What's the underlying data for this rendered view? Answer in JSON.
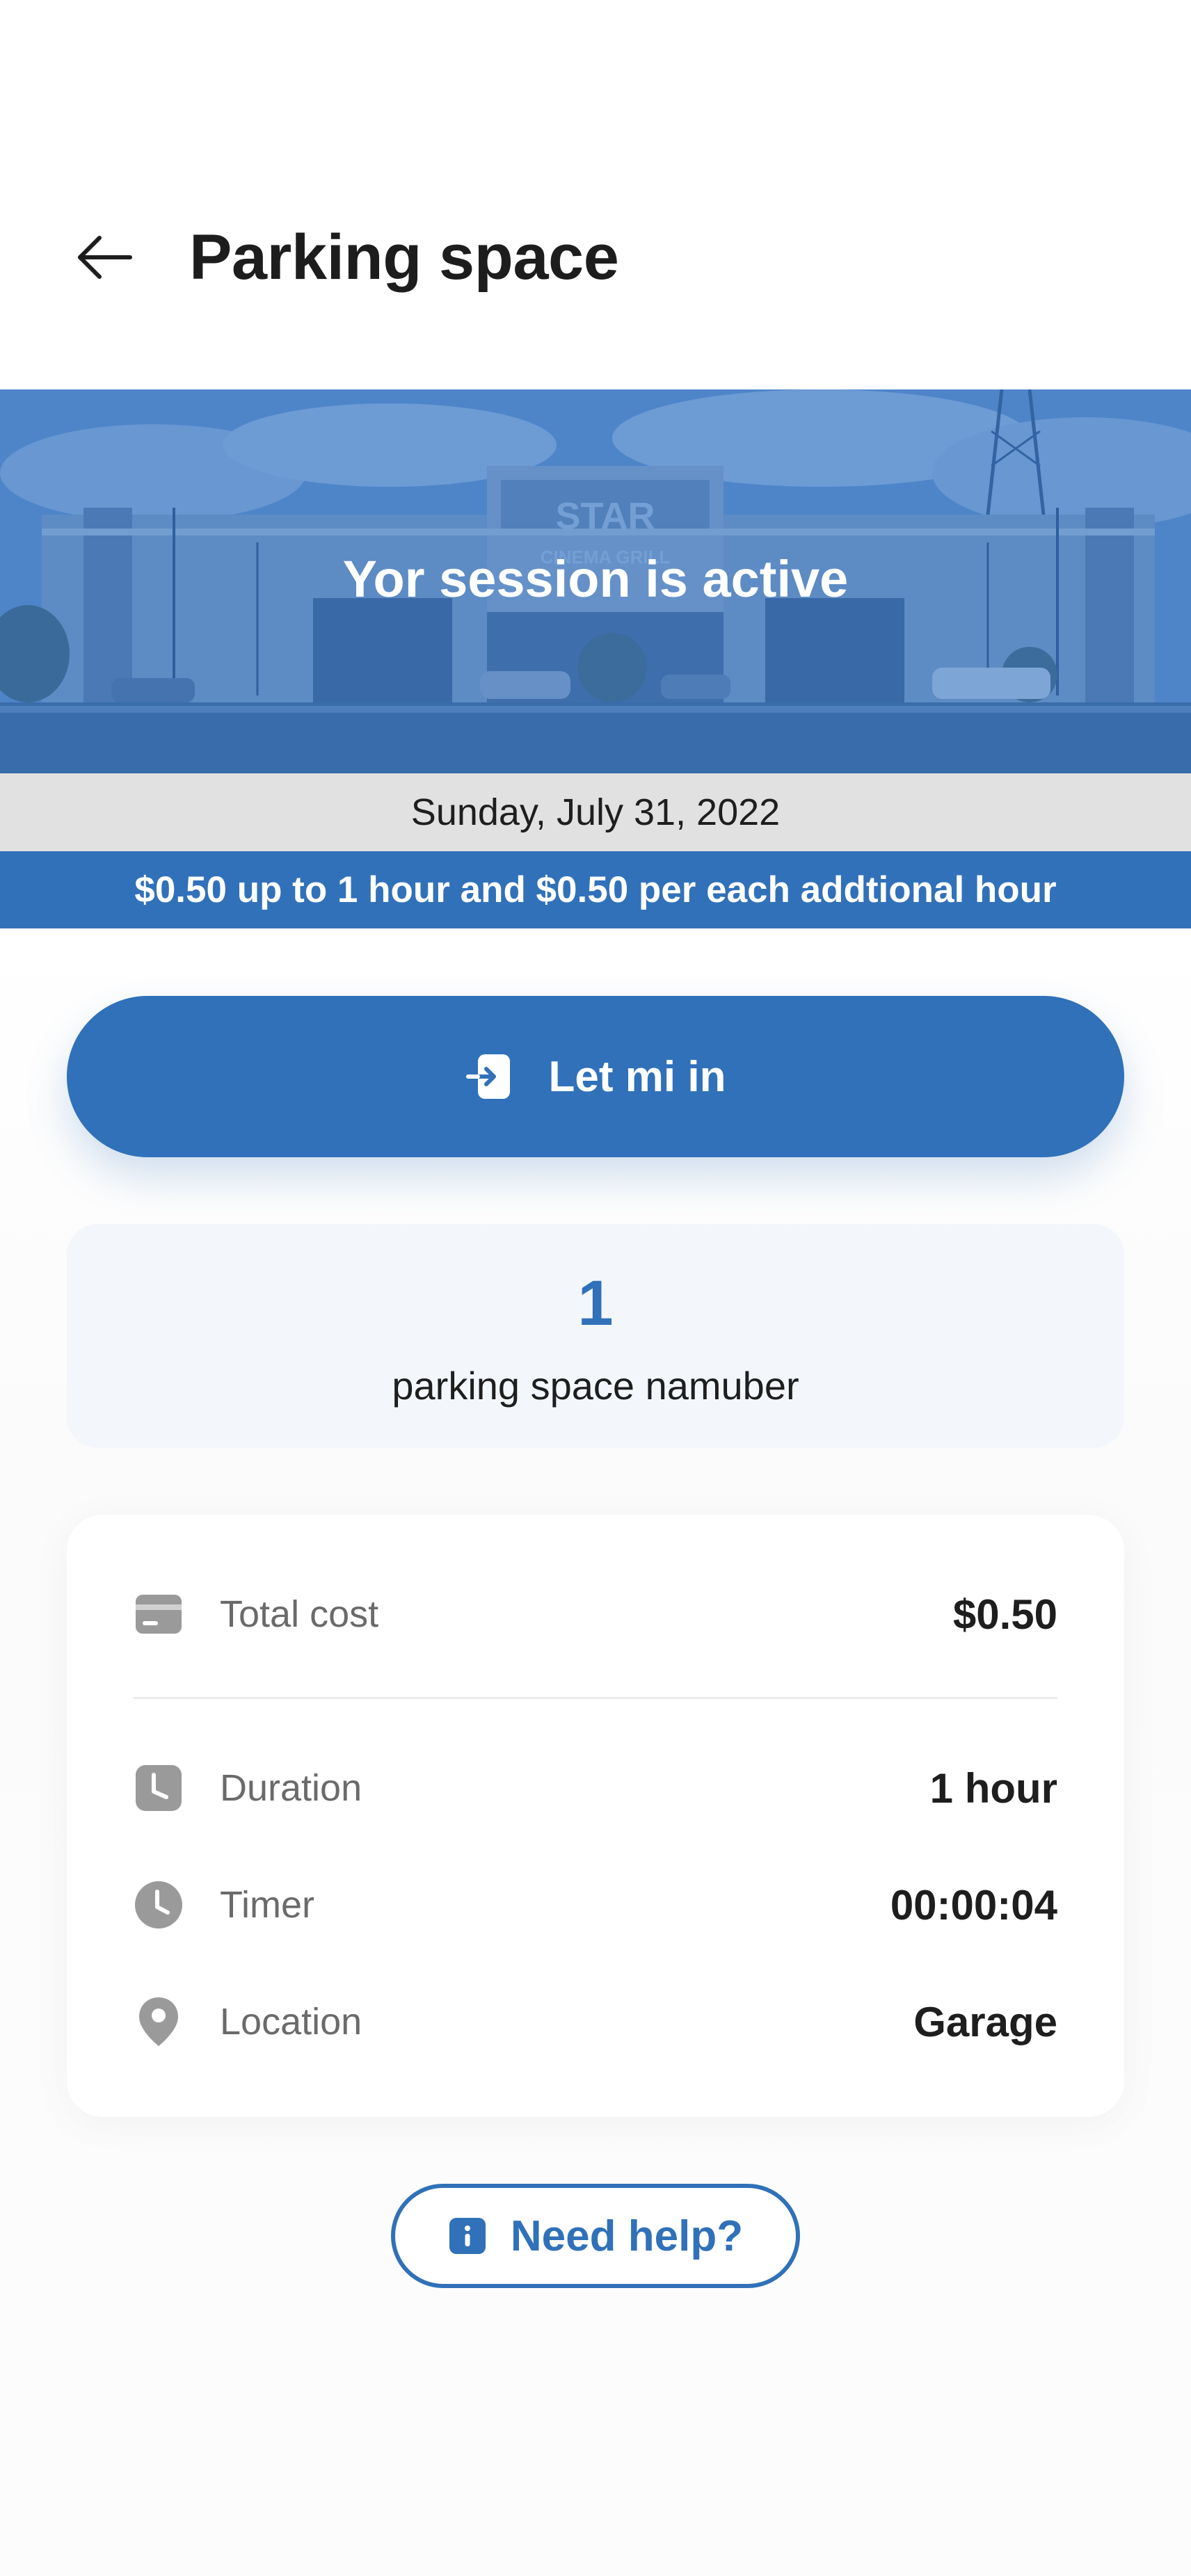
{
  "header": {
    "title": "Parking space",
    "back_icon": "arrow-left-icon"
  },
  "hero": {
    "session_status": "Yor session is active",
    "building_sign": "STAR",
    "building_sign_sub": "CINEMA GRILL",
    "tint_color": "#3d7cc6"
  },
  "date_strip": {
    "date": "Sunday, July 31, 2022"
  },
  "rate_strip": {
    "text": "$0.50 up to 1 hour and $0.50 per each addtional hour"
  },
  "enter_button": {
    "label": "Let mi in",
    "icon": "enter-door-icon"
  },
  "space": {
    "number": "1",
    "caption": "parking space namuber"
  },
  "details": {
    "rows": [
      {
        "icon": "card-icon",
        "label": "Total cost",
        "value": "$0.50"
      },
      {
        "icon": "calendar-clock-icon",
        "label": "Duration",
        "value": "1 hour"
      },
      {
        "icon": "clock-icon",
        "label": "Timer",
        "value": "00:00:04"
      },
      {
        "icon": "location-pin-icon",
        "label": "Location",
        "value": "Garage"
      }
    ]
  },
  "help_button": {
    "label": "Need help?",
    "icon": "info-icon"
  },
  "colors": {
    "primary": "#3071b9",
    "date_strip_bg": "#e1e1e1",
    "space_card_bg": "#f3f7fc",
    "icon_gray": "#9a9a9a"
  }
}
